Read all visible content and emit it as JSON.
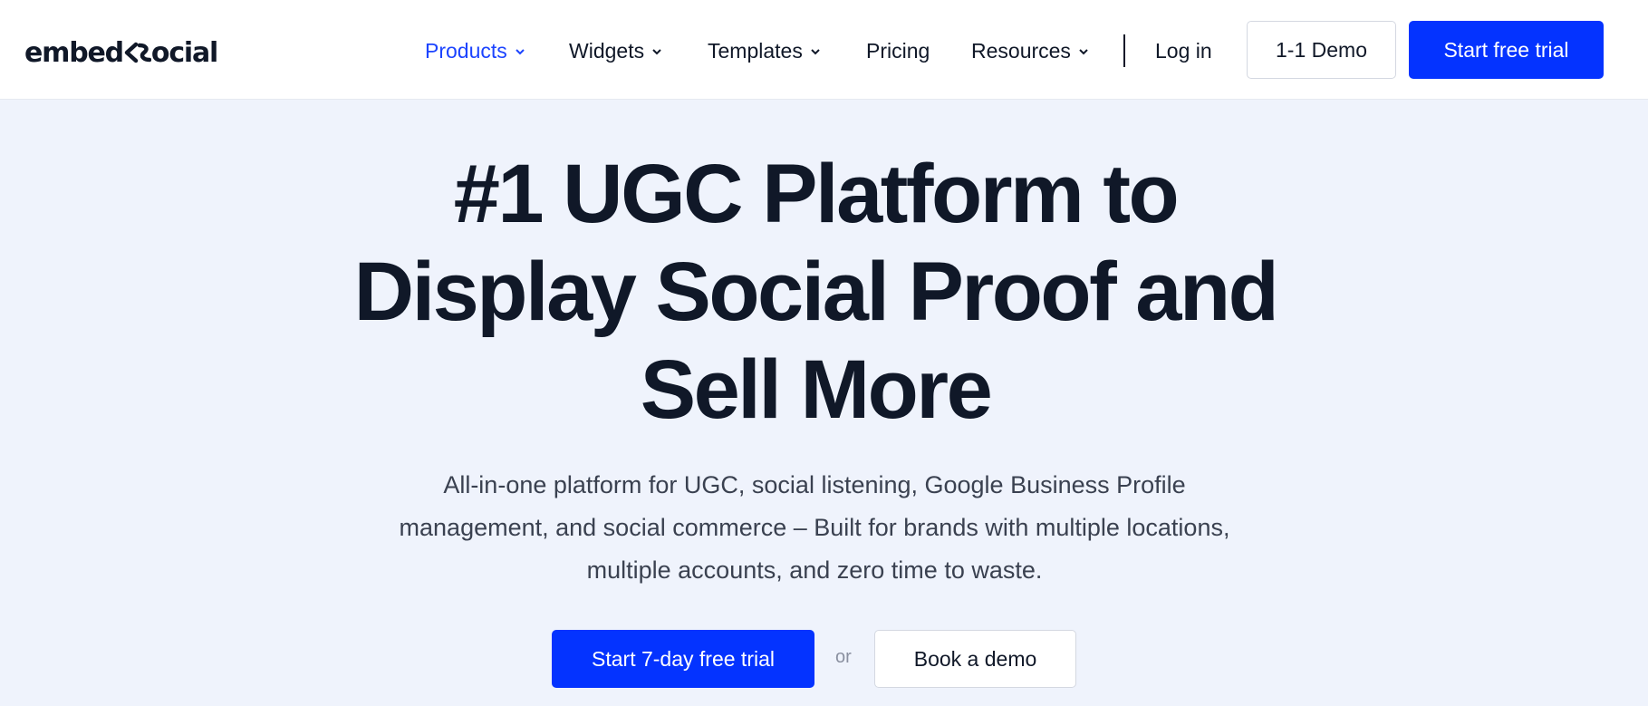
{
  "logo": {
    "text_left": "embed",
    "text_right": "ocial",
    "icon": "embedsocial-arrow-icon"
  },
  "nav": {
    "items": [
      {
        "label": "Products",
        "has_dropdown": true,
        "active": true
      },
      {
        "label": "Widgets",
        "has_dropdown": true,
        "active": false
      },
      {
        "label": "Templates",
        "has_dropdown": true,
        "active": false
      },
      {
        "label": "Pricing",
        "has_dropdown": false,
        "active": false
      },
      {
        "label": "Resources",
        "has_dropdown": true,
        "active": false
      }
    ],
    "login_label": "Log in",
    "demo_label": "1-1 Demo",
    "trial_label": "Start free trial"
  },
  "hero": {
    "title_lines": [
      "#1 UGC Platform to",
      "Display Social Proof and",
      "Sell More"
    ],
    "subtitle_lines": [
      "All-in-one platform for UGC, social listening, Google Business Profile",
      "management, and social commerce – Built for brands with multiple locations,",
      "multiple accounts, and zero time to waste."
    ],
    "cta_primary": "Start 7-day free trial",
    "or_text": "or",
    "cta_secondary": "Book a demo"
  },
  "colors": {
    "accent": "#0433ff",
    "active_nav": "#1c44ff",
    "hero_bg": "#eff3fc",
    "text": "#101828"
  }
}
